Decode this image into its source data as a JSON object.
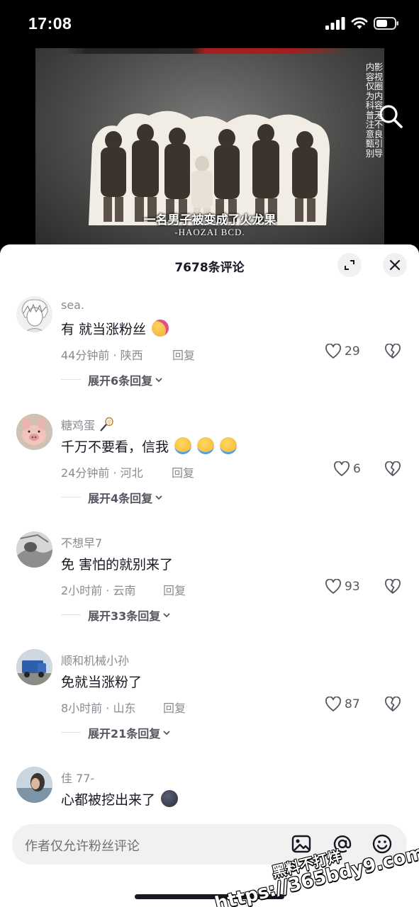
{
  "status_bar": {
    "time": "17:08"
  },
  "video": {
    "subtitle_cn": "一名男子被变成了火龙果",
    "subtitle_en": "-HAOZAI   BCD.",
    "disclaimer_1": "影视圈内容无不良引导",
    "disclaimer_2": "内容仅为科普注意甄别",
    "icon": "search-icon"
  },
  "comments_sheet": {
    "title": "7678条评论",
    "expand_icon": "expand-icon",
    "close_icon": "close-icon",
    "comments": [
      {
        "username": "sea.",
        "text": "有 就当涨粉丝",
        "emoji": [
          "hugging-face-emoji"
        ],
        "time_location": "44分钟前 · 陕西",
        "reply_label": "回复",
        "likes": "29",
        "replies": "展开6条回复"
      },
      {
        "username": "糖鸡蛋",
        "username_emoji": "badminton-emoji",
        "text": "千万不要看，信我",
        "emoji": [
          "crying-face-emoji",
          "crying-face-emoji",
          "crying-face-emoji"
        ],
        "time_location": "24分钟前 · 河北",
        "reply_label": "回复",
        "likes": "6",
        "replies": "展开4条回复"
      },
      {
        "username": "不想早7",
        "text": "免 害怕的就别来了",
        "emoji": [],
        "time_location": "2小时前 · 云南",
        "reply_label": "回复",
        "likes": "93",
        "replies": "展开33条回复"
      },
      {
        "username": "顺和机械小孙",
        "text": "免就当涨粉了",
        "emoji": [],
        "time_location": "8小时前 · 山东",
        "reply_label": "回复",
        "likes": "87",
        "replies": "展开21条回复"
      },
      {
        "username": "佳 77-",
        "text": "心都被挖出来了",
        "emoji": [
          "dark-moon-face-emoji"
        ]
      }
    ]
  },
  "input_bar": {
    "placeholder": "作者仅允许粉丝评论",
    "icons": [
      "image-icon",
      "mention-icon",
      "emoji-icon"
    ]
  },
  "watermark": {
    "line1": "黑料不打烊",
    "line2": "https://365bdy9.com"
  },
  "colors": {
    "sheet_bg": "#ffffff",
    "muted_text": "#8a8b91",
    "primary_text": "#161823",
    "input_bg": "#f1f1f2"
  }
}
